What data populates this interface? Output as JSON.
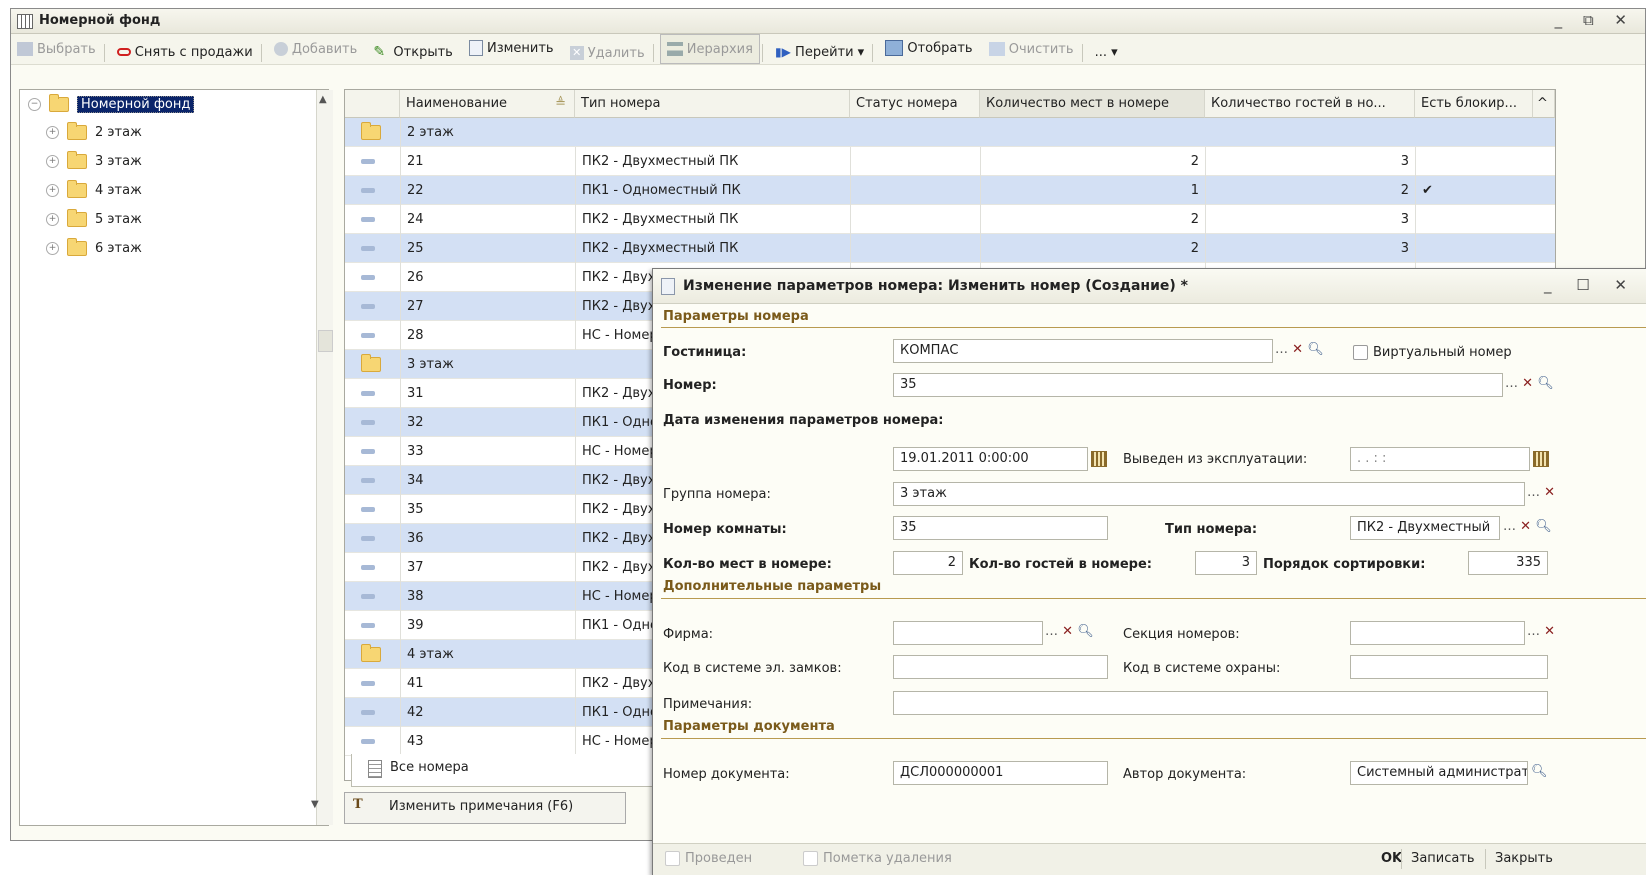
{
  "main": {
    "title": "Номерной фонд",
    "toolbar": {
      "select": "Выбрать",
      "remove_sale": "Снять с продажи",
      "add": "Добавить",
      "open": "Открыть",
      "edit": "Изменить",
      "delete": "Удалить",
      "hierarchy": "Иерархия",
      "goto": "Перейти",
      "filter": "Отобрать",
      "clear": "Очистить",
      "more": "..."
    }
  },
  "tree": {
    "root": "Номерной фонд",
    "items": [
      "2 этаж",
      "3 этаж",
      "4 этаж",
      "5 этаж",
      "6 этаж"
    ]
  },
  "grid": {
    "headers": [
      "Наименование",
      "Тип номера",
      "Статус номера",
      "Количество мест в номере",
      "Количество гостей в но...",
      "Есть блокир..."
    ],
    "rows": [
      {
        "kind": "group",
        "name": "2 этаж"
      },
      {
        "kind": "item",
        "name": "21",
        "type": "ПК2 - Двухместный ПК",
        "places": "2",
        "guests": "3",
        "block": ""
      },
      {
        "kind": "item",
        "name": "22",
        "type": "ПК1 - Одноместный ПК",
        "places": "1",
        "guests": "2",
        "block": "✔"
      },
      {
        "kind": "item",
        "name": "24",
        "type": "ПК2 - Двухместный ПК",
        "places": "2",
        "guests": "3",
        "block": ""
      },
      {
        "kind": "item",
        "name": "25",
        "type": "ПК2 - Двухместный ПК",
        "places": "2",
        "guests": "3",
        "block": ""
      },
      {
        "kind": "item",
        "name": "26",
        "type": "ПК2 - Двух",
        "places": "",
        "guests": "",
        "block": ""
      },
      {
        "kind": "item",
        "name": "27",
        "type": "ПК2 - Двух",
        "places": "",
        "guests": "",
        "block": ""
      },
      {
        "kind": "item",
        "name": "28",
        "type": "НС - Номер",
        "places": "",
        "guests": "",
        "block": ""
      },
      {
        "kind": "group",
        "name": "3 этаж"
      },
      {
        "kind": "item",
        "name": "31",
        "type": "ПК2 - Двух",
        "places": "",
        "guests": "",
        "block": ""
      },
      {
        "kind": "item",
        "name": "32",
        "type": "ПК1 - Одно",
        "places": "",
        "guests": "",
        "block": ""
      },
      {
        "kind": "item",
        "name": "33",
        "type": "НС - Номер",
        "places": "",
        "guests": "",
        "block": ""
      },
      {
        "kind": "item",
        "name": "34",
        "type": "ПК2 - Двух",
        "places": "",
        "guests": "",
        "block": ""
      },
      {
        "kind": "item",
        "name": "35",
        "type": "ПК2 - Двух",
        "places": "",
        "guests": "",
        "block": ""
      },
      {
        "kind": "item",
        "name": "36",
        "type": "ПК2 - Двух",
        "places": "",
        "guests": "",
        "block": ""
      },
      {
        "kind": "item",
        "name": "37",
        "type": "ПК2 - Двух",
        "places": "",
        "guests": "",
        "block": ""
      },
      {
        "kind": "item",
        "name": "38",
        "type": "НС - Номер",
        "places": "",
        "guests": "",
        "block": ""
      },
      {
        "kind": "item",
        "name": "39",
        "type": "ПК1 - Одно",
        "places": "",
        "guests": "",
        "block": ""
      },
      {
        "kind": "group",
        "name": "4 этаж"
      },
      {
        "kind": "item",
        "name": "41",
        "type": "ПК2 - Двух",
        "places": "",
        "guests": "",
        "block": ""
      },
      {
        "kind": "item",
        "name": "42",
        "type": "ПК1 - Одно",
        "places": "",
        "guests": "",
        "block": ""
      },
      {
        "kind": "item",
        "name": "43",
        "type": "НС - Номер",
        "places": "",
        "guests": "",
        "block": ""
      }
    ],
    "tab_label": "Все номера",
    "notes_button": "Изменить примечания (F6)",
    "notes_icon_glyph": "T"
  },
  "dialog": {
    "title": "Изменение параметров номера: Изменить номер (Создание) *",
    "sections": {
      "room_params": "Параметры номера",
      "extra_params": "Дополнительные параметры",
      "doc_params": "Параметры документа"
    },
    "labels": {
      "hotel": "Гостиница:",
      "virtual": "Виртуальный номер",
      "number": "Номер:",
      "change_date": "Дата изменения параметров номера:",
      "decommissioned": "Выведен из эксплуатации:",
      "room_group": "Группа номера:",
      "room_no": "Номер комнаты:",
      "room_type": "Тип номера:",
      "places": "Кол-во мест в номере:",
      "guests": "Кол-во гостей в номере:",
      "sort": "Порядок сортировки:",
      "firm": "Фирма:",
      "section": "Секция номеров:",
      "lock_code": "Код в системе эл. замков:",
      "security_code": "Код в системе охраны:",
      "notes": "Примечания:",
      "doc_number": "Номер документа:",
      "doc_author": "Автор документа:"
    },
    "values": {
      "hotel": "КОМПАС",
      "number": "35",
      "date": "19.01.2011  0:00:00",
      "decommissioned": " .  .       :  :",
      "room_group": "3 этаж",
      "room_no": "35",
      "room_type": "ПК2 - Двухместный",
      "places": "2",
      "guests": "3",
      "sort": "335",
      "firm": "",
      "section": "",
      "lock_code": "",
      "security_code": "",
      "notes": "",
      "doc_number": "ДСЛ000000001",
      "doc_author": "Системный администрат"
    },
    "footer": {
      "posted": "Проведен",
      "deletion_mark": "Пометка удаления",
      "ok": "OK",
      "save": "Записать",
      "close": "Закрыть"
    }
  }
}
